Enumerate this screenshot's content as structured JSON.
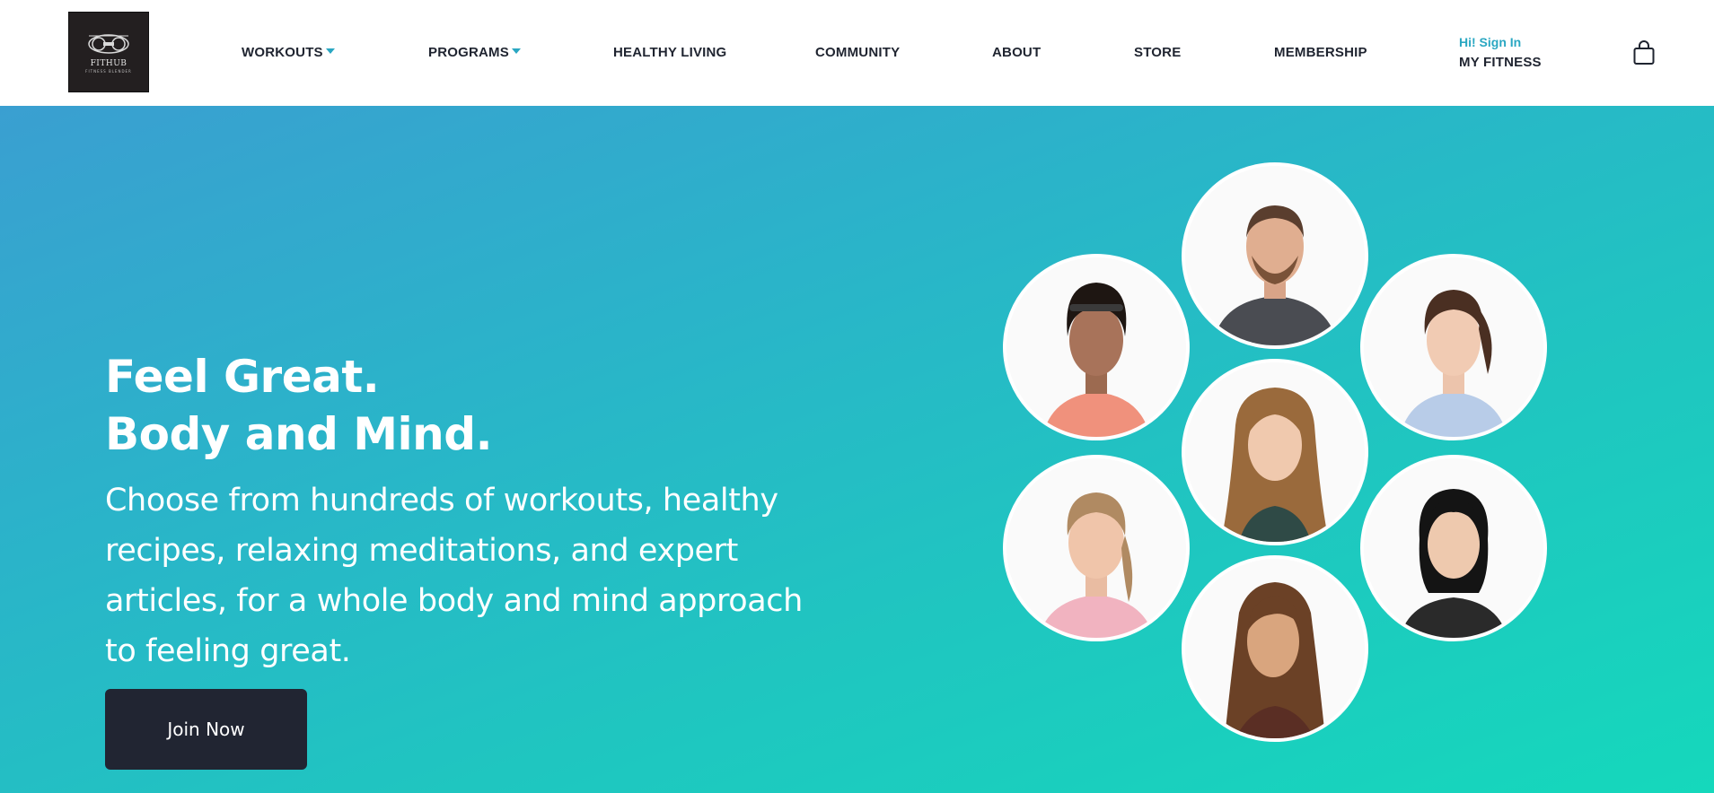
{
  "header": {
    "logo": {
      "name": "FITHUB",
      "tagline": "FITNESS BLENDER"
    },
    "nav": [
      {
        "label": "WORKOUTS",
        "has_dropdown": true
      },
      {
        "label": "PROGRAMS",
        "has_dropdown": true
      },
      {
        "label": "HEALTHY LIVING",
        "has_dropdown": false
      },
      {
        "label": "COMMUNITY",
        "has_dropdown": false
      },
      {
        "label": "ABOUT",
        "has_dropdown": false
      },
      {
        "label": "STORE",
        "has_dropdown": false
      },
      {
        "label": "MEMBERSHIP",
        "has_dropdown": false
      }
    ],
    "account": {
      "signin": "Hi! Sign In",
      "my_fitness": "MY FITNESS"
    },
    "cart_icon": "shopping-bag-icon"
  },
  "hero": {
    "headline_line1": "Feel Great.",
    "headline_line2": "Body and Mind.",
    "subtext": "Choose from hundreds of workouts, healthy recipes, relaxing meditations, and expert articles, for a whole body and mind approach to feeling great.",
    "cta_label": "Join Now"
  },
  "colors": {
    "accent": "#2aa7c2",
    "dark_button": "#212532",
    "gradient_start": "#3a9fd1",
    "gradient_end": "#15d8bc"
  }
}
